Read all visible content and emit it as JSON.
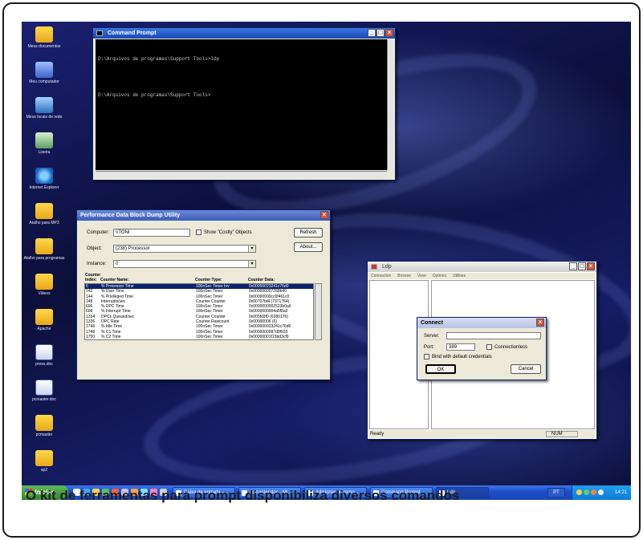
{
  "caption": "O kit de ferramentas para prompt disponibiliza diversos comandos",
  "desktop_icons": [
    {
      "label": "Meus documentos",
      "kind": "folder"
    },
    {
      "label": "Meu computador",
      "kind": "pc"
    },
    {
      "label": "Meus locais de rede",
      "kind": "net"
    },
    {
      "label": "Lixeira",
      "kind": "bin"
    },
    {
      "label": "Internet Explorer",
      "kind": "ie"
    },
    {
      "label": "Atalho para MP3",
      "kind": "folder"
    },
    {
      "label": "Atalho para programas",
      "kind": "folder"
    },
    {
      "label": "Videos",
      "kind": "folder"
    },
    {
      "label": "Apache",
      "kind": "folder"
    },
    {
      "label": "press.doc",
      "kind": "doc"
    },
    {
      "label": "pcmaster.doc",
      "kind": "doc"
    },
    {
      "label": "pcmaster",
      "kind": "folder"
    },
    {
      "label": "sp2",
      "kind": "folder"
    }
  ],
  "cmd": {
    "title": "Command Prompt",
    "lines": [
      "D:\\Arquivos de programas\\Support Tools>ldp",
      "",
      "D:\\Arquivos de programas\\Support Tools>"
    ]
  },
  "perf": {
    "title": "Performance Data Block Dump Utility",
    "computer_label": "Computer:",
    "computer_value": "\\\\TONI",
    "costly_label": "Show \"Costly\" Objects",
    "refresh_label": "Refresh",
    "about_label": "About...",
    "object_label": "Object:",
    "object_value": "(238) Processor",
    "instance_label": "Instance:",
    "instance_value": "0",
    "headers": [
      "Counter Index:",
      "Counter Name:",
      "Counter Type:",
      "Counter Data:"
    ],
    "rows": [
      [
        "6",
        "% Processor Time",
        "100nSec Timer Inv",
        "0x00000023241c76d0"
      ],
      [
        "142",
        "% User Time",
        "100nSec Timer",
        "0x000000007268b40"
      ],
      [
        "144",
        "% Privileged Time",
        "100nSec Timer",
        "0x00000000cc0f461c0"
      ],
      [
        "148",
        "Interrupts/sec",
        "Counter Counter",
        "0x00707bf4 (7371764)"
      ],
      [
        "696",
        "% DPC Time",
        "100nSec Timer",
        "0x0000000002523b0a0"
      ],
      [
        "698",
        "% Interrupt Time",
        "100nSec Timer",
        "0x0000000004a5f8a0"
      ],
      [
        "1334",
        "DPCs Queued/sec",
        "Counter Counter",
        "0x005fd3f0 (6280176)"
      ],
      [
        "1336",
        "DPC Rate",
        "Counter Rawcount",
        "0x00000006 (6)"
      ],
      [
        "1746",
        "% Idle Time",
        "100nSec Timer",
        "0x000000023241c76d0"
      ],
      [
        "1748",
        "% C1 Time",
        "100nSec Timer",
        "0x0000000097d9f933"
      ],
      [
        "1750",
        "% C2 Time",
        "100nSec Timer",
        "0x00000001f15bd3cf9"
      ]
    ]
  },
  "ldp": {
    "title": "Ldp",
    "menus": [
      "Connection",
      "Browse",
      "View",
      "Options",
      "Utilities"
    ],
    "status": "Ready",
    "num": "NUM"
  },
  "connect": {
    "title": "Connect",
    "server_label": "Server:",
    "server_value": "",
    "port_label": "Port:",
    "port_value": "389",
    "connectionless_label": "Connectionless",
    "bind_label": "Bind with default credentials",
    "ok_label": "OK",
    "cancel_label": "Cancel"
  },
  "taskbar": {
    "start_label": "Iniciar",
    "tasks": [
      {
        "label": "Caixa de entrada -...",
        "active": false
      },
      {
        "label": "pcmaster.doc - Mi...",
        "active": false
      },
      {
        "label": "Adicionar ou remo...",
        "active": false
      },
      {
        "label": "Command Prompt",
        "active": false
      },
      {
        "label": "Ldp",
        "active": true
      }
    ],
    "lang": "PT",
    "clock": "14:21"
  }
}
